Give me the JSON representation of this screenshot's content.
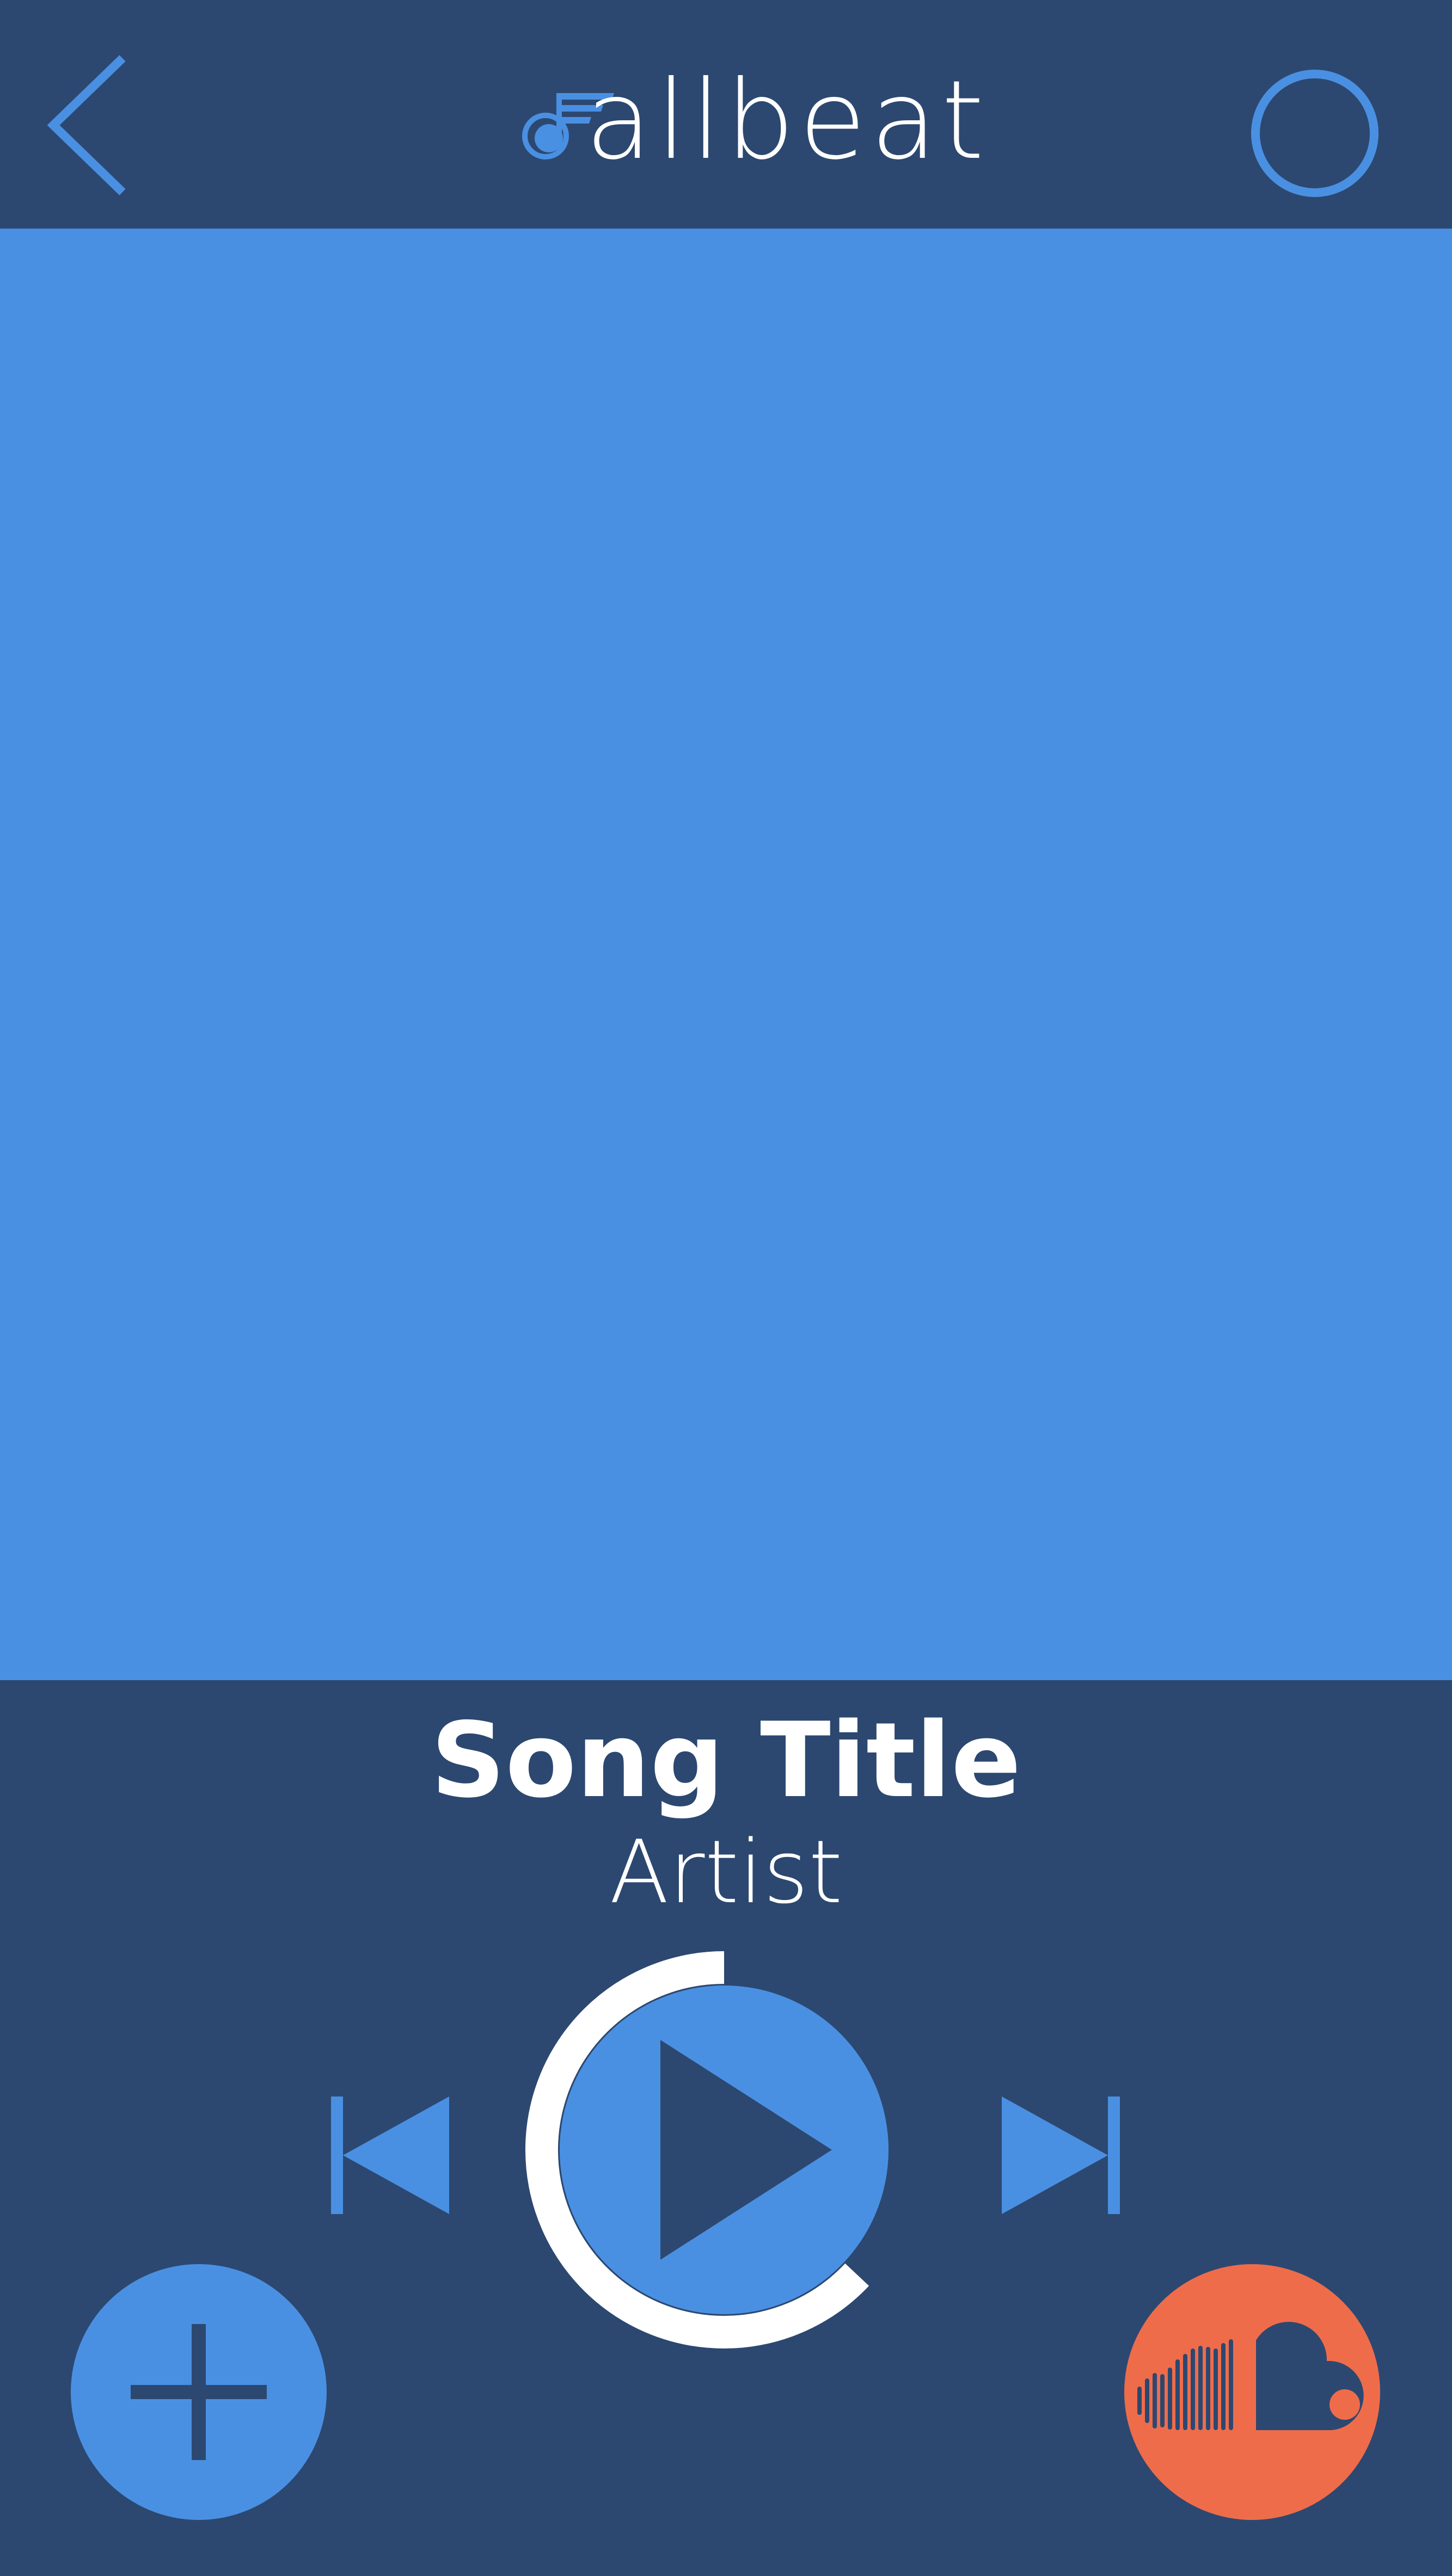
{
  "header": {
    "logo_text": "allbeat",
    "back_icon": "chevron-left-icon",
    "profile_icon": "circle-icon"
  },
  "player": {
    "song_title": "Song Title",
    "artist": "Artist",
    "progress": 0.37,
    "play_icon": "play-icon",
    "prev_icon": "skip-previous-icon",
    "next_icon": "skip-next-icon"
  },
  "actions": {
    "add_icon": "plus-icon",
    "soundcloud_icon": "soundcloud-icon"
  },
  "colors": {
    "background": "#2c4870",
    "accent": "#4a90e2",
    "text": "#ffffff",
    "soundcloud": "#ef6c4b"
  }
}
